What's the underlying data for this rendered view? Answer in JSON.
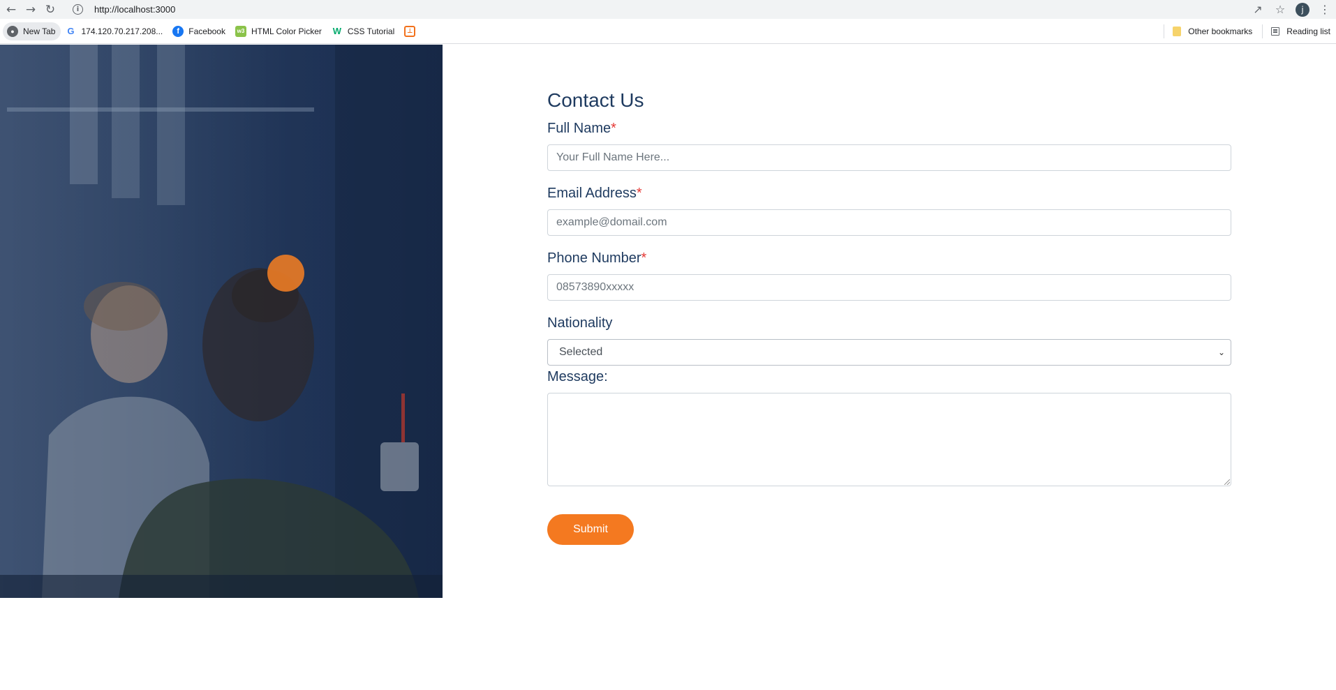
{
  "browser": {
    "url": "http://localhost:3000",
    "profile_initial": "j",
    "bookmarks": [
      {
        "label": "New Tab",
        "icon": "new-tab-icon"
      },
      {
        "label": "174.120.70.217.208...",
        "icon": "google-icon"
      },
      {
        "label": "Facebook",
        "icon": "facebook-icon"
      },
      {
        "label": "HTML Color Picker",
        "icon": "w3schools-icon"
      },
      {
        "label": "CSS Tutorial",
        "icon": "w3-icon"
      },
      {
        "label": "",
        "icon": "codecademy-icon"
      }
    ],
    "other_bookmarks": "Other bookmarks",
    "reading_list": "Reading list"
  },
  "form": {
    "title": "Contact Us",
    "full_name": {
      "label": "Full Name",
      "required": "*",
      "placeholder": "Your Full Name Here..."
    },
    "email": {
      "label": "Email Address",
      "required": "*",
      "placeholder": "example@domail.com"
    },
    "phone": {
      "label": "Phone Number",
      "required": "*",
      "placeholder": "08573890xxxxx"
    },
    "nationality": {
      "label": "Nationality",
      "selected": "Selected"
    },
    "message": {
      "label": "Message:",
      "value": ""
    },
    "submit_label": "Submit"
  },
  "colors": {
    "accent": "#f47920",
    "heading": "#1e3a5f",
    "required": "#e53935",
    "hero_overlay": "#1c3257"
  }
}
